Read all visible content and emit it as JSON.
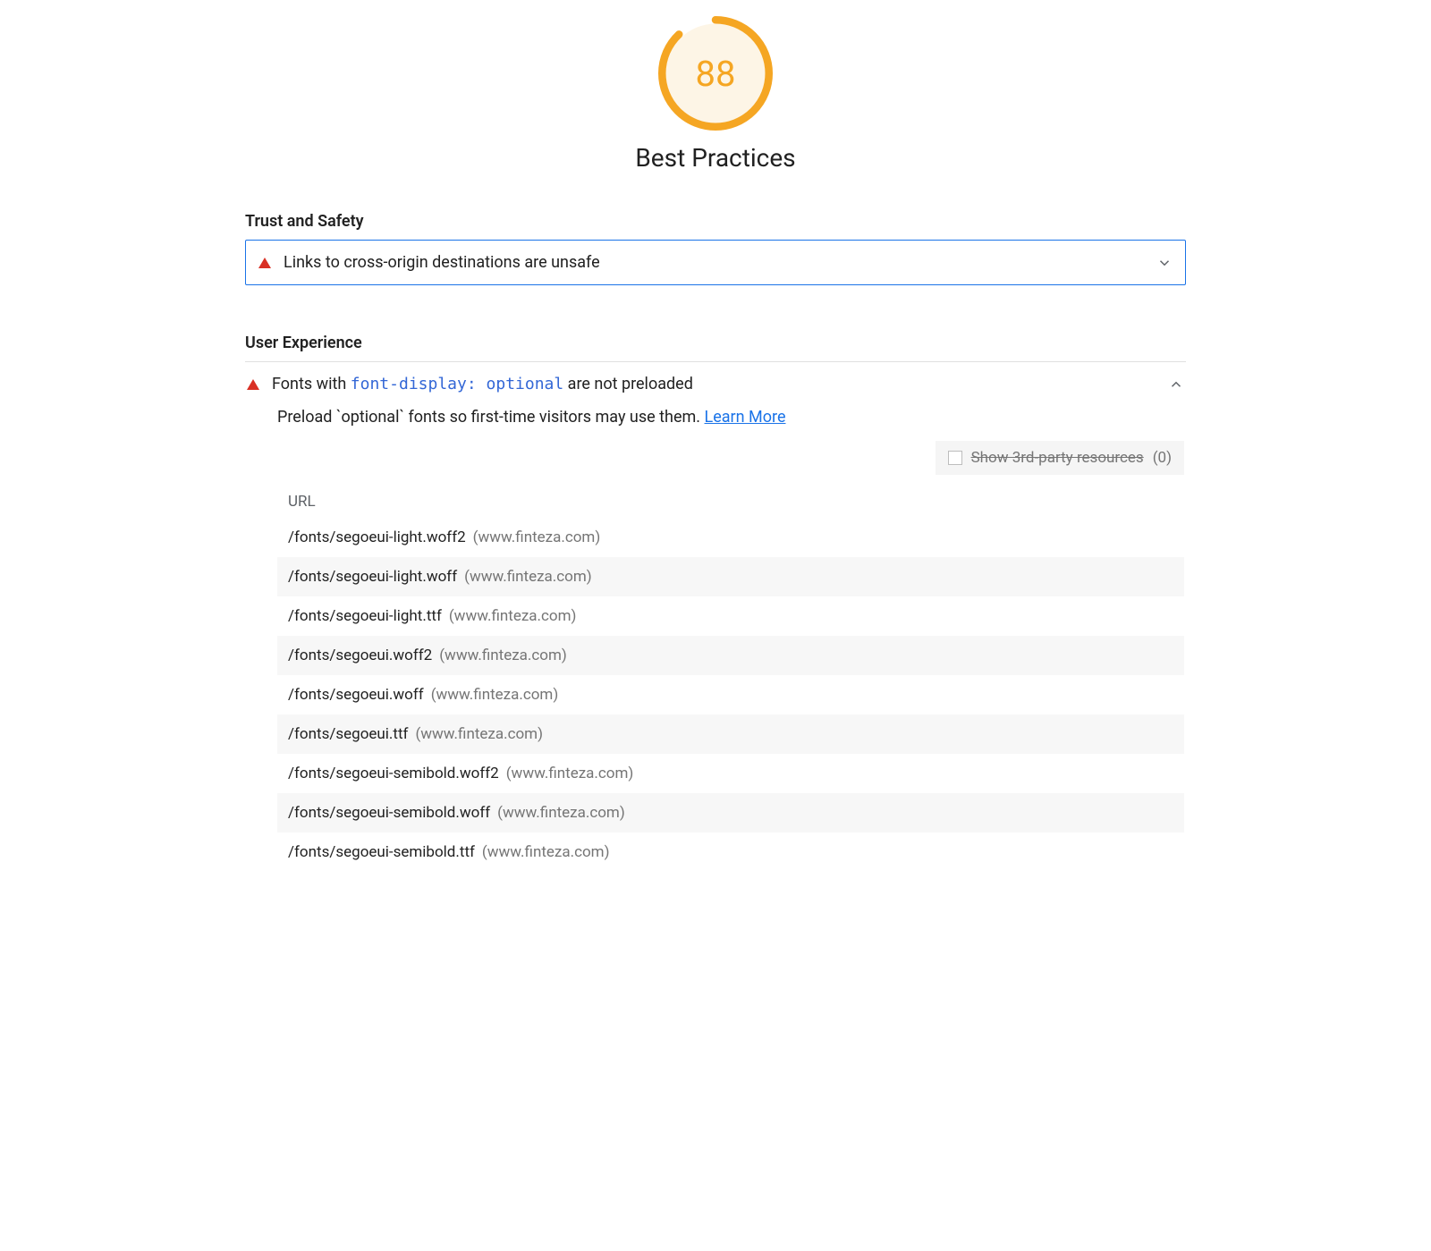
{
  "score": {
    "value": "88",
    "percent": 0.88,
    "color": "#f5a623",
    "fill": "#fdf5e6"
  },
  "category_title": "Best Practices",
  "sections": {
    "trust": {
      "title": "Trust and Safety",
      "audit_title": "Links to cross-origin destinations are unsafe"
    },
    "ux": {
      "title": "User Experience",
      "audit_title_prefix": "Fonts with ",
      "audit_title_code": "font-display: optional",
      "audit_title_suffix": " are not preloaded",
      "description_text": "Preload `optional` fonts so first-time visitors may use them. ",
      "learn_more": "Learn More",
      "third_party_label": "Show 3rd-party resources",
      "third_party_count": "(0)",
      "table_header": "URL",
      "rows": [
        {
          "path": "/fonts/segoeui-light.woff2",
          "host": "(www.finteza.com)"
        },
        {
          "path": "/fonts/segoeui-light.woff",
          "host": "(www.finteza.com)"
        },
        {
          "path": "/fonts/segoeui-light.ttf",
          "host": "(www.finteza.com)"
        },
        {
          "path": "/fonts/segoeui.woff2",
          "host": "(www.finteza.com)"
        },
        {
          "path": "/fonts/segoeui.woff",
          "host": "(www.finteza.com)"
        },
        {
          "path": "/fonts/segoeui.ttf",
          "host": "(www.finteza.com)"
        },
        {
          "path": "/fonts/segoeui-semibold.woff2",
          "host": "(www.finteza.com)"
        },
        {
          "path": "/fonts/segoeui-semibold.woff",
          "host": "(www.finteza.com)"
        },
        {
          "path": "/fonts/segoeui-semibold.ttf",
          "host": "(www.finteza.com)"
        }
      ]
    }
  }
}
